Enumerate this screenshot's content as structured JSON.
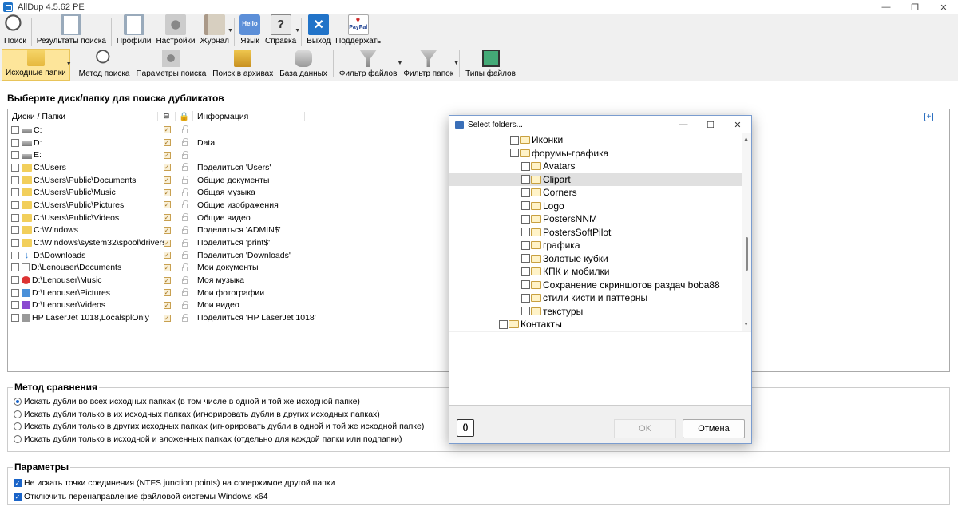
{
  "window": {
    "title": "AllDup 4.5.62 PE",
    "minimize": "—",
    "restore": "❐",
    "close": "✕"
  },
  "toolbar1": [
    {
      "name": "search",
      "label": "Поиск",
      "icon": "search-icon"
    },
    {
      "name": "results",
      "label": "Результаты поиска",
      "icon": "results-icon"
    },
    {
      "name": "profiles",
      "label": "Профили",
      "icon": "profiles-icon"
    },
    {
      "name": "settings",
      "label": "Настройки",
      "icon": "settings-icon"
    },
    {
      "name": "journal",
      "label": "Журнал",
      "icon": "journal-icon"
    },
    {
      "name": "language",
      "label": "Язык",
      "icon": "hello-icon",
      "icon_text": "Hello"
    },
    {
      "name": "help",
      "label": "Справка",
      "icon": "help-icon",
      "icon_text": "?"
    },
    {
      "name": "exit",
      "label": "Выход",
      "icon": "exit-icon",
      "icon_text": "✕"
    },
    {
      "name": "donate",
      "label": "Поддержать",
      "icon": "paypal-icon",
      "icon_text": "PayPal"
    }
  ],
  "toolbar2": [
    {
      "name": "source-folders",
      "label": "Исходные папки",
      "active": true
    },
    {
      "name": "search-method",
      "label": "Метод поиска"
    },
    {
      "name": "search-params",
      "label": "Параметры поиска"
    },
    {
      "name": "archive-search",
      "label": "Поиск в архивах"
    },
    {
      "name": "database",
      "label": "База данных"
    },
    {
      "name": "file-filter",
      "label": "Фильтр файлов"
    },
    {
      "name": "folder-filter",
      "label": "Фильтр папок"
    },
    {
      "name": "file-types",
      "label": "Типы файлов"
    }
  ],
  "section_title": "Выберите диск/папку для поиска дубликатов",
  "list": {
    "headers": {
      "name": "Диски / Папки",
      "info": "Информация"
    },
    "rows": [
      {
        "path": "C:",
        "icon": "drive-icon",
        "info": ""
      },
      {
        "path": "D:",
        "icon": "drive-icon",
        "info": "Data"
      },
      {
        "path": "E:",
        "icon": "drive-icon",
        "info": ""
      },
      {
        "path": "C:\\Users",
        "icon": "folder-icon",
        "info": "Поделиться 'Users'"
      },
      {
        "path": "C:\\Users\\Public\\Documents",
        "icon": "folder-icon",
        "info": "Общие документы"
      },
      {
        "path": "C:\\Users\\Public\\Music",
        "icon": "folder-icon",
        "info": "Общая музыка"
      },
      {
        "path": "C:\\Users\\Public\\Pictures",
        "icon": "folder-icon",
        "info": "Общие изображения"
      },
      {
        "path": "C:\\Users\\Public\\Videos",
        "icon": "folder-icon",
        "info": "Общие видео"
      },
      {
        "path": "C:\\Windows",
        "icon": "folder-icon",
        "info": "Поделиться 'ADMIN$'"
      },
      {
        "path": "C:\\Windows\\system32\\spool\\drivers",
        "icon": "folder-icon",
        "info": "Поделиться 'print$'"
      },
      {
        "path": "D:\\Downloads",
        "icon": "download-icon",
        "info": "Поделиться 'Downloads'"
      },
      {
        "path": "D:\\Lenouser\\Documents",
        "icon": "documents-icon",
        "info": "Мои документы"
      },
      {
        "path": "D:\\Lenouser\\Music",
        "icon": "music-icon",
        "info": "Моя музыка"
      },
      {
        "path": "D:\\Lenouser\\Pictures",
        "icon": "pictures-icon",
        "info": "Мои фотографии"
      },
      {
        "path": "D:\\Lenouser\\Videos",
        "icon": "videos-icon",
        "info": "Мои видео"
      },
      {
        "path": "HP LaserJet 1018,LocalsplOnly",
        "icon": "printer-icon",
        "info": "Поделиться 'HP LaserJet 1018'"
      }
    ]
  },
  "compare_method": {
    "title": "Метод сравнения",
    "options": [
      {
        "label": "Искать дубли во всех исходных папках (в том числе в одной и той же исходной папке)",
        "selected": true
      },
      {
        "label": "Искать дубли только в их исходных папках (игнорировать дубли в других исходных папках)",
        "selected": false
      },
      {
        "label": "Искать дубли только в других исходных папках (игнорировать дубли в одной и той же исходной папке)",
        "selected": false
      },
      {
        "label": "Искать дубли только в исходной и вложенных папках (отдельно для каждой папки или подпапки)",
        "selected": false
      }
    ]
  },
  "params": {
    "title": "Параметры",
    "options": [
      {
        "label": "Не искать точки соединения (NTFS junction points) на содержимое другой папки",
        "checked": true
      },
      {
        "label": "Отключить перенаправление файловой системы Windows x64",
        "checked": true
      }
    ]
  },
  "dialog": {
    "title": "Select folders...",
    "tree": [
      {
        "label": "Иконки",
        "level": 2,
        "selected": false
      },
      {
        "label": "форумы-графика",
        "level": 2,
        "selected": false
      },
      {
        "label": "Avatars",
        "level": 3,
        "selected": false
      },
      {
        "label": "Clipart",
        "level": 3,
        "selected": true
      },
      {
        "label": "Corners",
        "level": 3,
        "selected": false
      },
      {
        "label": "Logo",
        "level": 3,
        "selected": false
      },
      {
        "label": "PostersNNM",
        "level": 3,
        "selected": false
      },
      {
        "label": "PostersSoftPilot",
        "level": 3,
        "selected": false
      },
      {
        "label": "графика",
        "level": 3,
        "selected": false
      },
      {
        "label": "Золотые кубки",
        "level": 3,
        "selected": false
      },
      {
        "label": "КПК и мобилки",
        "level": 3,
        "selected": false
      },
      {
        "label": "Сохранение скриншотов раздач boba88",
        "level": 3,
        "selected": false
      },
      {
        "label": "стили кисти и паттерны",
        "level": 3,
        "selected": false
      },
      {
        "label": "текстуры",
        "level": 3,
        "selected": false
      },
      {
        "label": "Контакты",
        "level": 1,
        "selected": false
      }
    ],
    "refresh_label": "()",
    "ok_label": "OK",
    "cancel_label": "Отмена"
  }
}
